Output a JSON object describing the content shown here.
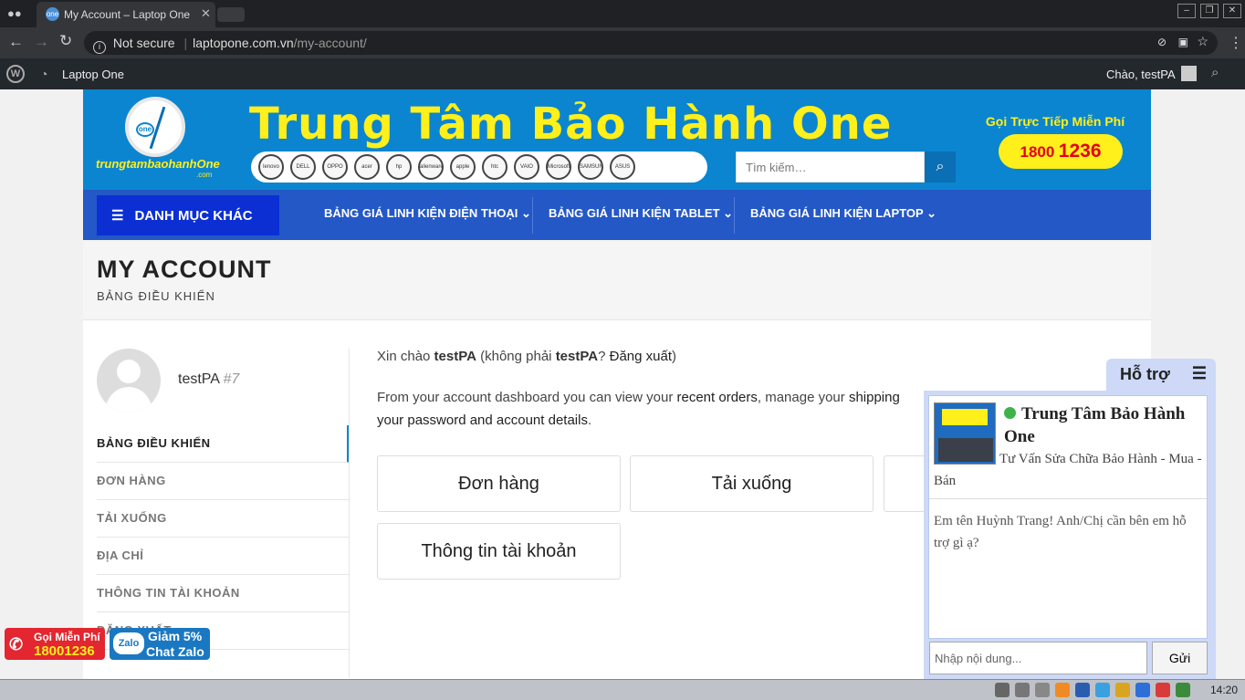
{
  "browser": {
    "tab_title": "My Account – Laptop One",
    "url_security": "Not secure",
    "url_domain": "laptopone.com.vn",
    "url_path": "/my-account/"
  },
  "admin_bar": {
    "site_name": "Laptop One",
    "greeting": "Chào, testPA"
  },
  "header": {
    "logo_text": "trungtambaohanhOne",
    "logo_sub": ".com",
    "title": "Trung Tâm Bảo Hành One",
    "brands": [
      "lenovo",
      "DELL",
      "OPPO",
      "acer",
      "hp",
      "alienware",
      "apple",
      "htc",
      "VAIO",
      "Microsoft",
      "SAMSUNG",
      "ASUS"
    ],
    "search_placeholder": "Tìm kiếm…",
    "hotline_label": "Gọi Trực Tiếp Miễn Phí",
    "hotline_prefix": "1800",
    "hotline_number": "1236"
  },
  "nav": {
    "menu_label": "DANH MỤC KHÁC",
    "items": [
      {
        "label": "BẢNG GIÁ LINH KIỆN ĐIỆN THOẠI"
      },
      {
        "label": "BẢNG GIÁ LINH KIỆN TABLET"
      },
      {
        "label": "BẢNG GIÁ LINH KIỆN LAPTOP"
      }
    ]
  },
  "page": {
    "title": "MY ACCOUNT",
    "breadcrumb": "BẢNG ĐIỀU KHIỂN"
  },
  "account": {
    "username": "testPA",
    "user_id": "#7",
    "menu": [
      {
        "label": "BẢNG ĐIỀU KHIỂN"
      },
      {
        "label": "ĐƠN HÀNG"
      },
      {
        "label": "TẢI XUỐNG"
      },
      {
        "label": "ĐỊA CHỈ"
      },
      {
        "label": "THÔNG TIN TÀI KHOẢN"
      },
      {
        "label": "ĐĂNG XUẤT"
      }
    ],
    "hello_prefix": "Xin chào ",
    "hello_name": "testPA",
    "hello_mid": " (không phải ",
    "hello_name2": "testPA",
    "hello_q": "? ",
    "logout": "Đăng xuất",
    "hello_end": ")",
    "dash_1": "From your account dashboard you can view your ",
    "dash_recent": "recent orders",
    "dash_2": ", manage your ",
    "dash_shipping": "shipping",
    "dash_3": "your password and account details",
    "dash_4": ".",
    "cards": [
      "Đơn hàng",
      "Tải xuống",
      "Thông tin tài khoản"
    ]
  },
  "chat": {
    "tab_label": "Hỗ trợ",
    "name": "Trung Tâm Bảo Hành One",
    "subtitle": "Tư Vấn Sửa Chữa Bảo Hành - Mua - Bán",
    "message": "Em tên Huỳnh Trang! Anh/Chị cần bên em hỗ trợ gì ạ?",
    "input_placeholder": "Nhập nội dung...",
    "send": "Gửi"
  },
  "float_buttons": {
    "call_label": "Gọi Miễn Phí",
    "call_number": "18001236",
    "zalo_icon": "Zalo",
    "zalo_line1": "Giảm 5%",
    "zalo_line2": "Chat Zalo"
  },
  "taskbar": {
    "clock": "14:20"
  },
  "colors": {
    "header_blue": "#0b85d0",
    "nav_blue": "#2458c6",
    "menu_button": "#0c2fd4",
    "brand_yellow": "#ffef1a",
    "hotline_red": "#e3001b"
  }
}
